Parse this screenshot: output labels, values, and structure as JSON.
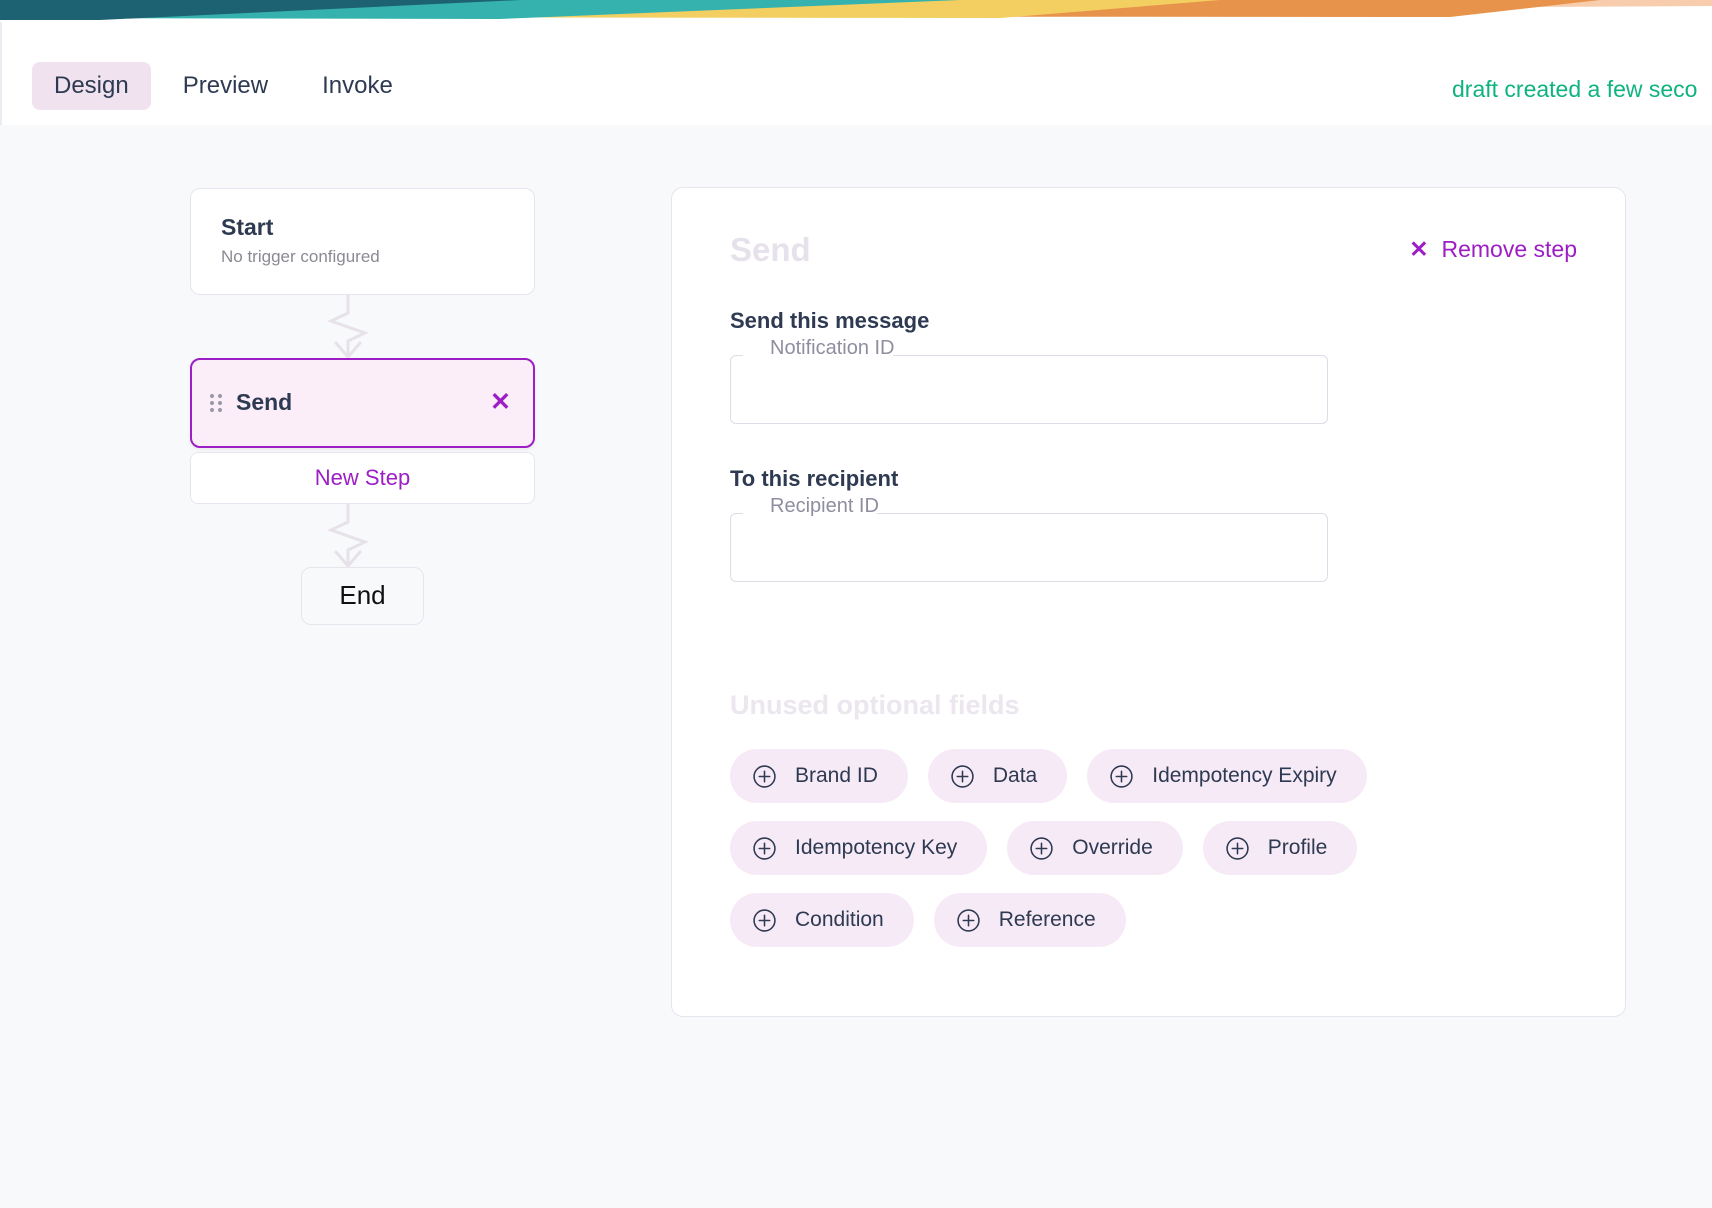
{
  "banner": {
    "name": "decorative-gradient-banner",
    "colors": [
      "#1d6273",
      "#35b2ad",
      "#f3cf61",
      "#e8934b",
      "#f8cdad"
    ]
  },
  "header": {
    "tabs": [
      {
        "label": "Design",
        "active": true
      },
      {
        "label": "Preview",
        "active": false
      },
      {
        "label": "Invoke",
        "active": false
      }
    ],
    "status": "draft created a few seco",
    "status_color": "#0fb37f"
  },
  "workflow": {
    "start": {
      "title": "Start",
      "subtitle": "No trigger configured"
    },
    "send_step": {
      "label": "Send",
      "close_icon": "close-icon"
    },
    "new_step": {
      "label": "New Step"
    },
    "end": {
      "label": "End"
    }
  },
  "panel": {
    "title": "Send",
    "remove_step": {
      "label": "Remove step",
      "icon": "close-icon"
    },
    "sections": [
      {
        "heading": "Send this message",
        "field": {
          "label": "Notification ID",
          "value": "",
          "placeholder": ""
        }
      },
      {
        "heading": "To this recipient",
        "field": {
          "label": "Recipient ID",
          "value": "",
          "placeholder": ""
        }
      }
    ],
    "optional": {
      "heading": "Unused optional fields",
      "chips": [
        {
          "label": "Brand ID"
        },
        {
          "label": "Data"
        },
        {
          "label": "Idempotency Expiry"
        },
        {
          "label": "Idempotency Key"
        },
        {
          "label": "Override"
        },
        {
          "label": "Profile"
        },
        {
          "label": "Condition"
        },
        {
          "label": "Reference"
        }
      ]
    }
  },
  "colors": {
    "accent_purple": "#9c1ec4",
    "chip_bg": "#f6eaf6",
    "step_bg": "#fbeef8",
    "text_dark": "#2e3a52",
    "page_bg": "#f8f9fb"
  }
}
